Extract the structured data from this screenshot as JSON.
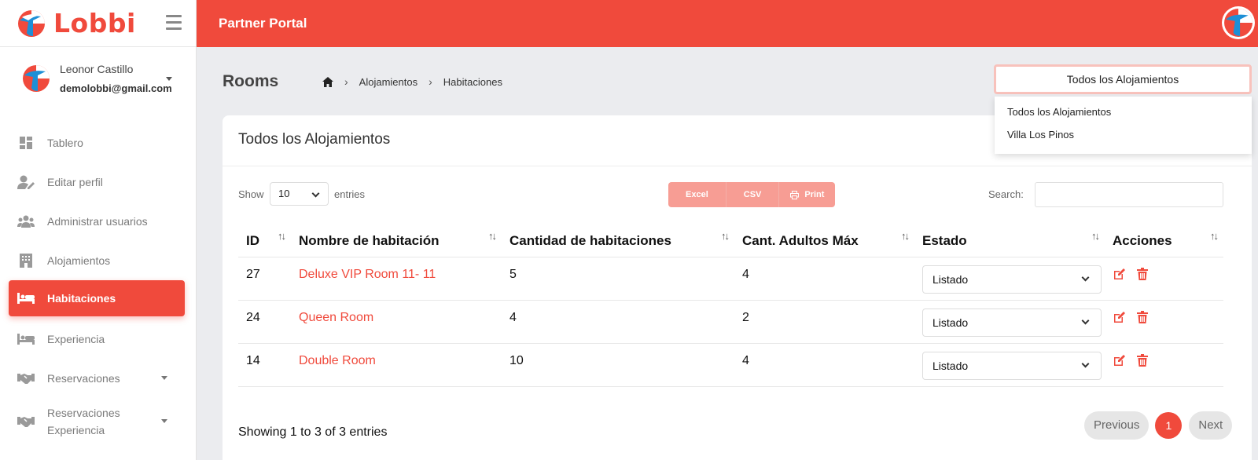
{
  "brand": {
    "name": "Lobbi",
    "accent": "#f04a3c"
  },
  "user": {
    "name": "Leonor Castillo",
    "email": "demolobbi@gmail.com"
  },
  "sidebar": {
    "items": [
      {
        "label": "Tablero",
        "icon": "dashboard-icon"
      },
      {
        "label": "Editar perfil",
        "icon": "user-edit-icon"
      },
      {
        "label": "Administrar usuarios",
        "icon": "users-icon"
      },
      {
        "label": "Alojamientos",
        "icon": "building-icon"
      },
      {
        "label": "Habitaciones",
        "icon": "bed-icon",
        "active": true
      },
      {
        "label": "Experiencia",
        "icon": "bed-icon"
      },
      {
        "label": "Reservaciones",
        "icon": "handshake-icon"
      },
      {
        "label": "Reservaciones Experiencia",
        "icon": "handshake-icon"
      }
    ]
  },
  "topbar": {
    "title": "Partner Portal"
  },
  "page": {
    "title": "Rooms"
  },
  "breadcrumb": {
    "items": [
      "Alojamientos",
      "Habitaciones"
    ]
  },
  "accommodation_select": {
    "value": "Todos los Alojamientos",
    "options": [
      "Todos los Alojamientos",
      "Villa Los Pinos"
    ]
  },
  "card": {
    "title": "Todos los Alojamientos"
  },
  "controls": {
    "show_label": "Show",
    "entries_value": "10",
    "entries_label": "entries",
    "buttons": [
      "Excel",
      "CSV",
      "Print"
    ],
    "search_label": "Search:"
  },
  "table": {
    "headers": [
      "ID",
      "Nombre de habitación",
      "Cantidad de habitaciones",
      "Cant. Adultos Máx",
      "Estado",
      "Acciones"
    ],
    "rows": [
      {
        "id": "27",
        "name": "Deluxe VIP Room 11- 11",
        "count": "5",
        "adults": "4",
        "status": "Listado"
      },
      {
        "id": "24",
        "name": "Queen Room",
        "count": "4",
        "adults": "2",
        "status": "Listado"
      },
      {
        "id": "14",
        "name": "Double Room",
        "count": "10",
        "adults": "4",
        "status": "Listado"
      }
    ]
  },
  "footer": {
    "info": "Showing 1 to 3 of 3 entries",
    "previous": "Previous",
    "page": "1",
    "next": "Next"
  }
}
